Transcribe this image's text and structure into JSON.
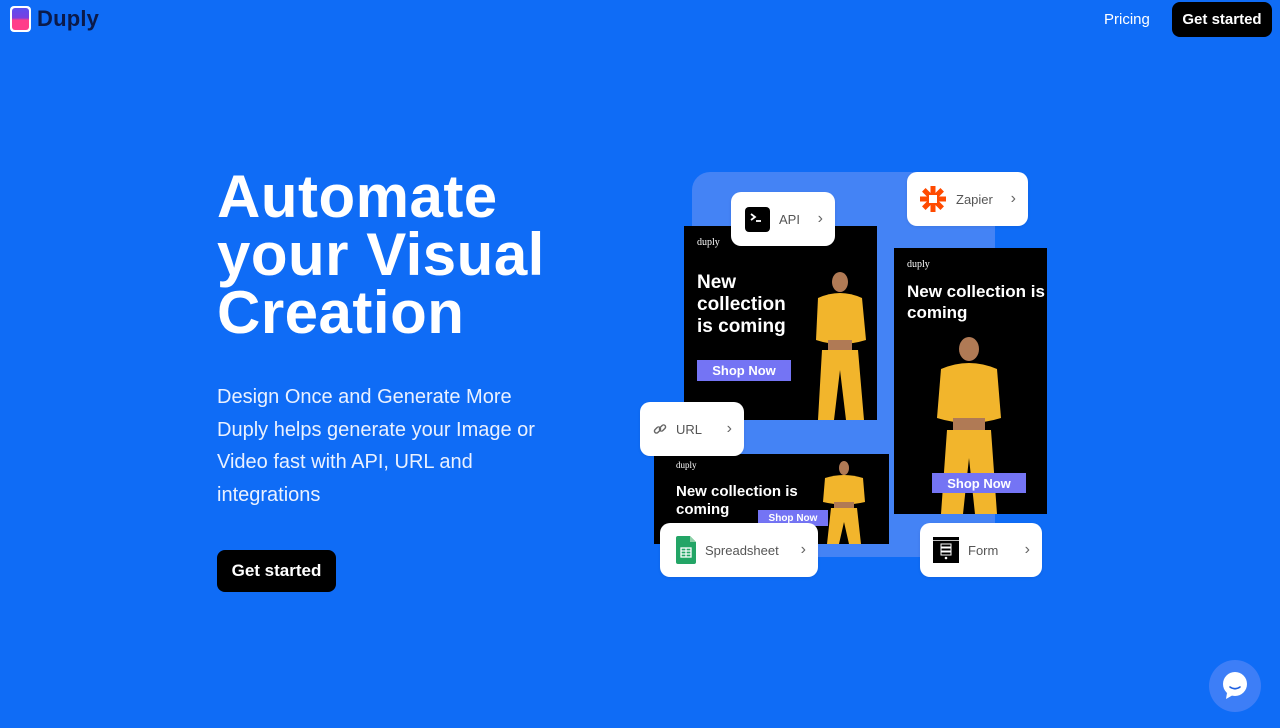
{
  "header": {
    "brand": "Duply",
    "nav": {
      "pricing": "Pricing",
      "cta": "Get started"
    }
  },
  "hero": {
    "title_lines": [
      "Automate",
      "your Visual",
      "Creation"
    ],
    "subtitle": "Design Once and Generate More Duply helps generate your Image or Video fast with API, URL and integrations",
    "cta": "Get started"
  },
  "collage": {
    "ads": [
      {
        "brand": "duply",
        "headline": "New collection is coming",
        "button": "Shop Now"
      },
      {
        "brand": "duply",
        "headline": "New collection is coming",
        "button": "Shop Now"
      },
      {
        "brand": "duply",
        "headline": "New collection is coming",
        "button": "Shop Now"
      }
    ],
    "integrations": [
      {
        "label": "API",
        "icon": "terminal-icon"
      },
      {
        "label": "Zapier",
        "icon": "zapier-icon"
      },
      {
        "label": "URL",
        "icon": "link-icon"
      },
      {
        "label": "Spreadsheet",
        "icon": "spreadsheet-icon"
      },
      {
        "label": "Form",
        "icon": "form-icon"
      }
    ]
  },
  "colors": {
    "background": "#0f6cf6",
    "panel": "#4483f5",
    "button": "#000000",
    "shop_button": "#7474f4",
    "zapier": "#ff4a00",
    "sheets": "#23a566"
  },
  "chat": {
    "icon": "chat-icon"
  }
}
